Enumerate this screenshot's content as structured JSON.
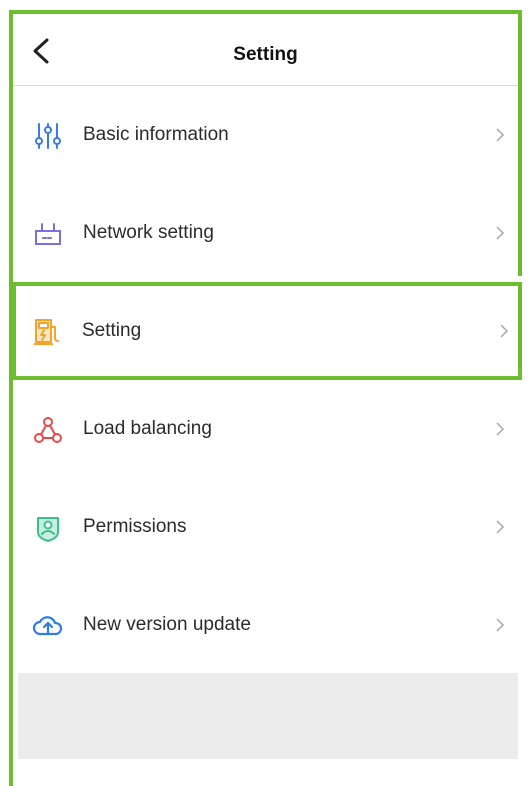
{
  "header": {
    "title": "Setting"
  },
  "menu": {
    "items": [
      {
        "label": "Basic information",
        "icon": "sliders-icon"
      },
      {
        "label": "Network setting",
        "icon": "router-icon"
      },
      {
        "label": "Setting",
        "icon": "charger-icon"
      },
      {
        "label": "Load balancing",
        "icon": "triangle-nodes-icon"
      },
      {
        "label": "Permissions",
        "icon": "shield-user-icon"
      },
      {
        "label": "New version update",
        "icon": "cloud-upload-icon"
      }
    ]
  },
  "colors": {
    "highlight": "#6cbd2f",
    "sliders": "#3a7be6",
    "router": "#7a6fe3",
    "charger": "#f1a32c",
    "triangle": "#e84a4a",
    "shield": "#3cbf8f",
    "cloud": "#2f7ce6"
  }
}
